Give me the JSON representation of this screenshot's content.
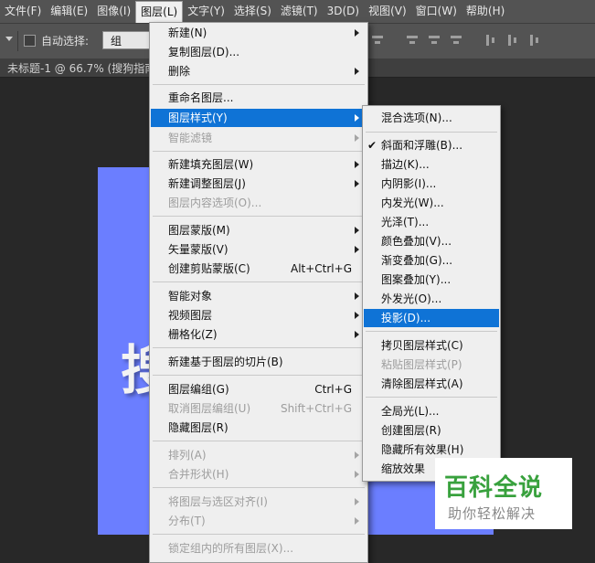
{
  "menubar": {
    "items": [
      "文件(F)",
      "编辑(E)",
      "图像(I)",
      "图层(L)",
      "文字(Y)",
      "选择(S)",
      "滤镜(T)",
      "3D(D)",
      "视图(V)",
      "窗口(W)",
      "帮助(H)"
    ],
    "open_item": "图层(L)"
  },
  "options_bar": {
    "auto_select_label": "自动选择:",
    "auto_select_value": "组"
  },
  "document": {
    "tab_title": "未标题-1 @ 66.7% (搜狗指南",
    "canvas_color": "#6b7eff",
    "canvas_text": "搜"
  },
  "layer_menu": {
    "items": [
      {
        "label": "新建(N)",
        "submenu": true
      },
      {
        "label": "复制图层(D)..."
      },
      {
        "label": "删除",
        "submenu": true
      },
      {
        "label": "重命名图层..."
      },
      {
        "label": "图层样式(Y)",
        "submenu": true,
        "highlight": true
      },
      {
        "label": "智能滤镜",
        "submenu": true,
        "disabled": true
      },
      {
        "label": "新建填充图层(W)",
        "submenu": true
      },
      {
        "label": "新建调整图层(J)",
        "submenu": true
      },
      {
        "label": "图层内容选项(O)...",
        "disabled": true
      },
      {
        "label": "图层蒙版(M)",
        "submenu": true
      },
      {
        "label": "矢量蒙版(V)",
        "submenu": true
      },
      {
        "label": "创建剪贴蒙版(C)",
        "shortcut": "Alt+Ctrl+G"
      },
      {
        "label": "智能对象",
        "submenu": true
      },
      {
        "label": "视频图层",
        "submenu": true
      },
      {
        "label": "栅格化(Z)",
        "submenu": true
      },
      {
        "label": "新建基于图层的切片(B)"
      },
      {
        "label": "图层编组(G)",
        "shortcut": "Ctrl+G"
      },
      {
        "label": "取消图层编组(U)",
        "shortcut": "Shift+Ctrl+G",
        "disabled": true
      },
      {
        "label": "隐藏图层(R)"
      },
      {
        "label": "排列(A)",
        "submenu": true,
        "disabled": true
      },
      {
        "label": "合并形状(H)",
        "submenu": true,
        "disabled": true
      },
      {
        "label": "将图层与选区对齐(I)",
        "submenu": true,
        "disabled": true
      },
      {
        "label": "分布(T)",
        "submenu": true,
        "disabled": true
      },
      {
        "label": "锁定组内的所有图层(X)...",
        "disabled": true
      }
    ]
  },
  "style_menu": {
    "items": [
      {
        "label": "混合选项(N)..."
      },
      {
        "label": "斜面和浮雕(B)...",
        "checked": true
      },
      {
        "label": "描边(K)..."
      },
      {
        "label": "内阴影(I)..."
      },
      {
        "label": "内发光(W)..."
      },
      {
        "label": "光泽(T)..."
      },
      {
        "label": "颜色叠加(V)..."
      },
      {
        "label": "渐变叠加(G)..."
      },
      {
        "label": "图案叠加(Y)..."
      },
      {
        "label": "外发光(O)..."
      },
      {
        "label": "投影(D)...",
        "highlight": true
      },
      {
        "label": "拷贝图层样式(C)"
      },
      {
        "label": "粘贴图层样式(P)",
        "disabled": true
      },
      {
        "label": "清除图层样式(A)"
      },
      {
        "label": "全局光(L)..."
      },
      {
        "label": "创建图层(R)"
      },
      {
        "label": "隐藏所有效果(H)"
      },
      {
        "label": "缩放效果"
      }
    ]
  },
  "watermark": {
    "main": "百科全说",
    "sub": "助你轻松解决",
    "color": "#38a13d"
  },
  "colors": {
    "highlight": "#0f73d6",
    "menu_bg": "#efefef",
    "ui_dark": "#535353"
  }
}
